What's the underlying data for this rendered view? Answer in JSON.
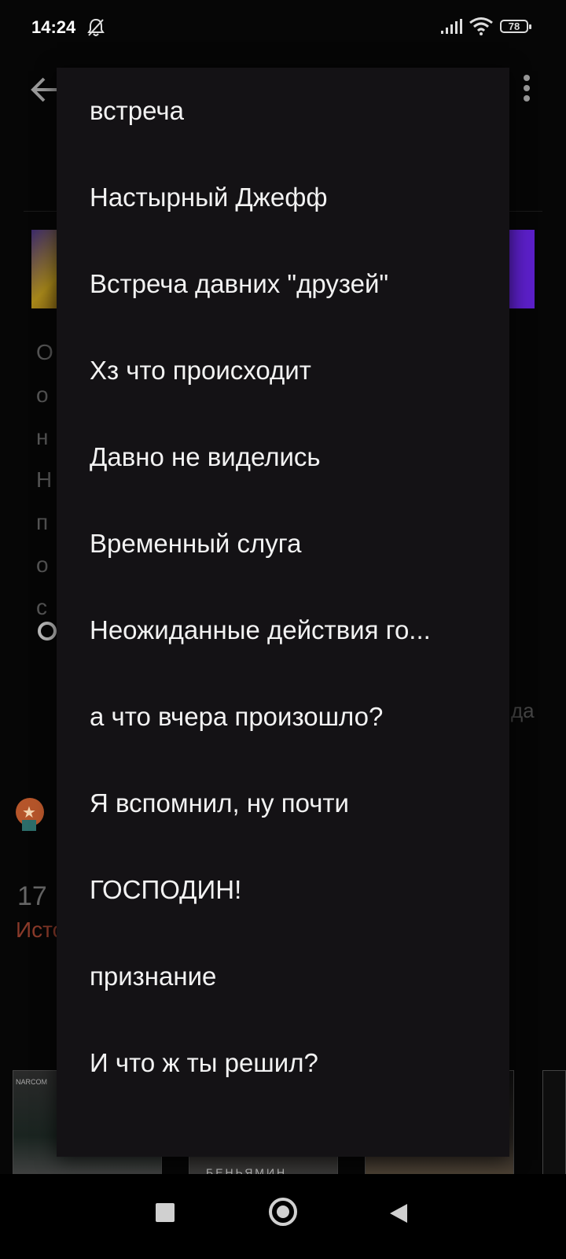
{
  "status_bar": {
    "time": "14:24",
    "battery": "78",
    "icons": [
      "bell-off-icon",
      "signal-icon",
      "wifi-icon",
      "battery-icon"
    ]
  },
  "background": {
    "peek_lines": [
      "О",
      "о",
      "н",
      "Н",
      "п",
      "о",
      "с"
    ],
    "peek_right": "да",
    "peek_number": "17",
    "peek_history": "Исто",
    "thumb_1_text": "NARCOM",
    "thumb_2_text": "БЕНЬЯМИН"
  },
  "menu": {
    "items": [
      "встреча",
      "Настырный Джефф",
      "Встреча давних \"друзей\"",
      "Хз что происходит",
      "Давно не виделись",
      "Временный слуга",
      "Неожиданные действия го...",
      "а что вчера произошло?",
      "Я вспомнил, ну почти",
      "ГОСПОДИН!",
      "признание",
      "И что ж ты решил?"
    ]
  },
  "nav_bar": {
    "icons": [
      "recents-icon",
      "home-icon",
      "back-icon"
    ]
  }
}
